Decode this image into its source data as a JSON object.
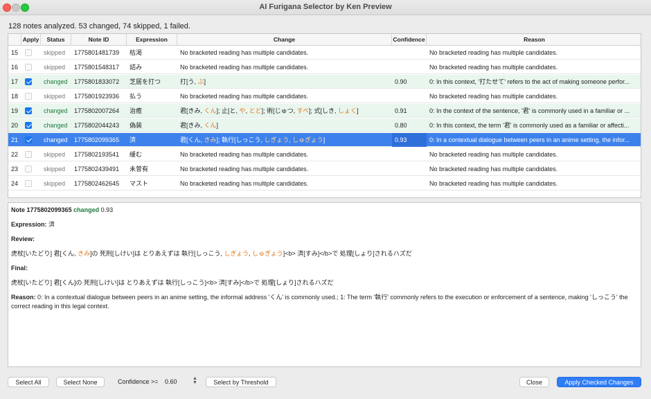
{
  "window": {
    "title": "AI Furigana Selector by Ken Preview"
  },
  "summary": "128 notes analyzed. 53 changed, 74 skipped, 1 failed.",
  "table": {
    "columns": [
      "Apply",
      "Status",
      "Note ID",
      "Expression",
      "Change",
      "Confidence",
      "Reason"
    ],
    "rows": [
      {
        "num": "15",
        "checked": false,
        "status": "skipped",
        "note_id": "1775801481739",
        "expression": "枯渇",
        "change": "No bracketed reading has multiple candidates.",
        "confidence": "",
        "reason": "No bracketed reading has multiple candidates."
      },
      {
        "num": "16",
        "checked": false,
        "status": "skipped",
        "note_id": "1775801548317",
        "expression": "詰み",
        "change": "No bracketed reading has multiple candidates.",
        "confidence": "",
        "reason": "No bracketed reading has multiple candidates."
      },
      {
        "num": "17",
        "checked": true,
        "status": "changed",
        "note_id": "1775801833072",
        "expression": "芝居を打つ",
        "change_parts": [
          [
            "打[う, ",
            false
          ],
          [
            "ぶ",
            true
          ],
          [
            "]",
            false
          ]
        ],
        "confidence": "0.90",
        "reason": "0: In this context, '打たせて' refers to the act of making someone perfor..."
      },
      {
        "num": "18",
        "checked": false,
        "status": "skipped",
        "note_id": "1775801923936",
        "expression": "払う",
        "change": "No bracketed reading has multiple candidates.",
        "confidence": "",
        "reason": "No bracketed reading has multiple candidates."
      },
      {
        "num": "19",
        "checked": true,
        "status": "changed",
        "note_id": "1775802007264",
        "expression": "治癒",
        "change_parts": [
          [
            "君[きみ, ",
            false
          ],
          [
            "くん",
            true
          ],
          [
            "]; 止[と, ",
            false
          ],
          [
            "や",
            true
          ],
          [
            ", ",
            false
          ],
          [
            "とど",
            true
          ],
          [
            "]; 術[じゅつ, ",
            false
          ],
          [
            "すべ",
            true
          ],
          [
            "]; 式[しき, ",
            false
          ],
          [
            "しょく",
            true
          ],
          [
            "]",
            false
          ]
        ],
        "confidence": "0.91",
        "reason": "0: In the context of the sentence, '君' is commonly used in a familiar or ..."
      },
      {
        "num": "20",
        "checked": true,
        "status": "changed",
        "note_id": "1775802044243",
        "expression": "偽装",
        "change_parts": [
          [
            "君[きみ, ",
            false
          ],
          [
            "くん",
            true
          ],
          [
            "]",
            false
          ]
        ],
        "confidence": "0.80",
        "reason": "0: In this context, the term '君' is commonly used as a familiar or affecti..."
      },
      {
        "num": "21",
        "checked": true,
        "status": "changed",
        "note_id": "1775802099365",
        "expression": "済",
        "selected": true,
        "change_parts": [
          [
            "君[くん, ",
            false
          ],
          [
            "きみ",
            true
          ],
          [
            "]; 執行[しっこう, ",
            false
          ],
          [
            "しぎょう",
            true
          ],
          [
            ", ",
            false
          ],
          [
            "しゅぎょう",
            true
          ],
          [
            "]",
            false
          ]
        ],
        "confidence": "0.93",
        "reason": "0: In a contextual dialogue between peers in an anime setting, the infor..."
      },
      {
        "num": "22",
        "checked": false,
        "status": "skipped",
        "note_id": "1775802193541",
        "expression": "緩む",
        "change": "No bracketed reading has multiple candidates.",
        "confidence": "",
        "reason": "No bracketed reading has multiple candidates."
      },
      {
        "num": "23",
        "checked": false,
        "status": "skipped",
        "note_id": "1775802439491",
        "expression": "未曽有",
        "change": "No bracketed reading has multiple candidates.",
        "confidence": "",
        "reason": "No bracketed reading has multiple candidates."
      },
      {
        "num": "24",
        "checked": false,
        "status": "skipped",
        "note_id": "1775802462645",
        "expression": "マスト",
        "change": "No bracketed reading has multiple candidates.",
        "confidence": "",
        "reason": "No bracketed reading has multiple candidates."
      }
    ]
  },
  "detail": {
    "note_label": "Note 1775802099365",
    "status": "changed",
    "confidence": "0.93",
    "expression_label": "Expression:",
    "expression": "済",
    "review_label": "Review:",
    "review_parts": [
      [
        "虎杖[いたどり] 君[くん, ",
        false
      ],
      [
        "きみ",
        true
      ],
      [
        "]の 死刑[しけい]は とりあえずは 執行[しっこう, ",
        false
      ],
      [
        "しぎょう",
        true
      ],
      [
        ", ",
        false
      ],
      [
        "しゅぎょう",
        true
      ],
      [
        "]<b> 済[すみ]</b>で 処理[しょり]されるハズだ",
        false
      ]
    ],
    "final_label": "Final:",
    "final": "虎杖[いたどり] 君[くん]の 死刑[しけい]は とりあえずは 執行[しっこう]<b> 済[すみ]</b>で 処理[しょり]されるハズだ",
    "reason_label": "Reason:",
    "reason": "0: In a contextual dialogue between peers in an anime setting, the informal address 'くん' is commonly used.; 1: The term '執行' commonly refers to the execution or enforcement of a sentence, making 'しっこう' the correct reading in this legal context."
  },
  "buttons": {
    "select_all": "Select All",
    "select_none": "Select None",
    "confidence_label": "Confidence >=",
    "confidence_value": "0.60",
    "select_threshold": "Select by Threshold",
    "close": "Close",
    "apply": "Apply Checked Changes"
  },
  "colors": {
    "accent": "#2e7cf6",
    "changed": "#1b7a3a",
    "highlight": "#e07a1f",
    "changed_row": "#e9f6ee",
    "selected_row": "#3d82ec"
  }
}
